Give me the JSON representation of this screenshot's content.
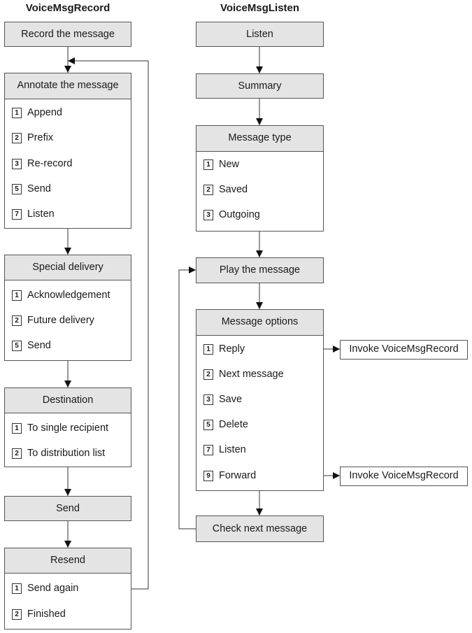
{
  "columns": [
    {
      "title": "VoiceMsgRecord",
      "steps": [
        {
          "label": "Record the message",
          "options": []
        },
        {
          "label": "Annotate the message",
          "options": [
            {
              "key": "1",
              "label": "Append"
            },
            {
              "key": "2",
              "label": "Prefix"
            },
            {
              "key": "3",
              "label": "Re-record"
            },
            {
              "key": "5",
              "label": "Send"
            },
            {
              "key": "7",
              "label": "Listen"
            }
          ]
        },
        {
          "label": "Special delivery",
          "options": [
            {
              "key": "1",
              "label": "Acknowledgement"
            },
            {
              "key": "2",
              "label": "Future delivery"
            },
            {
              "key": "5",
              "label": "Send"
            }
          ]
        },
        {
          "label": "Destination",
          "options": [
            {
              "key": "1",
              "label": "To single recipient"
            },
            {
              "key": "2",
              "label": "To distribution list"
            }
          ]
        },
        {
          "label": "Send",
          "options": []
        },
        {
          "label": "Resend",
          "options": [
            {
              "key": "1",
              "label": "Send again"
            },
            {
              "key": "2",
              "label": "Finished"
            }
          ]
        }
      ]
    },
    {
      "title": "VoiceMsgListen",
      "steps": [
        {
          "label": "Listen",
          "options": []
        },
        {
          "label": "Summary",
          "options": []
        },
        {
          "label": "Message type",
          "options": [
            {
              "key": "1",
              "label": "New"
            },
            {
              "key": "2",
              "label": "Saved"
            },
            {
              "key": "3",
              "label": "Outgoing"
            }
          ]
        },
        {
          "label": "Play the message",
          "options": []
        },
        {
          "label": "Message options",
          "options": [
            {
              "key": "1",
              "label": "Reply"
            },
            {
              "key": "2",
              "label": "Next message"
            },
            {
              "key": "3",
              "label": "Save"
            },
            {
              "key": "5",
              "label": "Delete"
            },
            {
              "key": "7",
              "label": "Listen"
            },
            {
              "key": "9",
              "label": "Forward"
            }
          ]
        },
        {
          "label": "Check next message",
          "options": []
        }
      ]
    }
  ],
  "invokes": [
    {
      "from": "Reply",
      "label": "Invoke VoiceMsgRecord"
    },
    {
      "from": "Forward",
      "label": "Invoke VoiceMsgRecord"
    }
  ]
}
